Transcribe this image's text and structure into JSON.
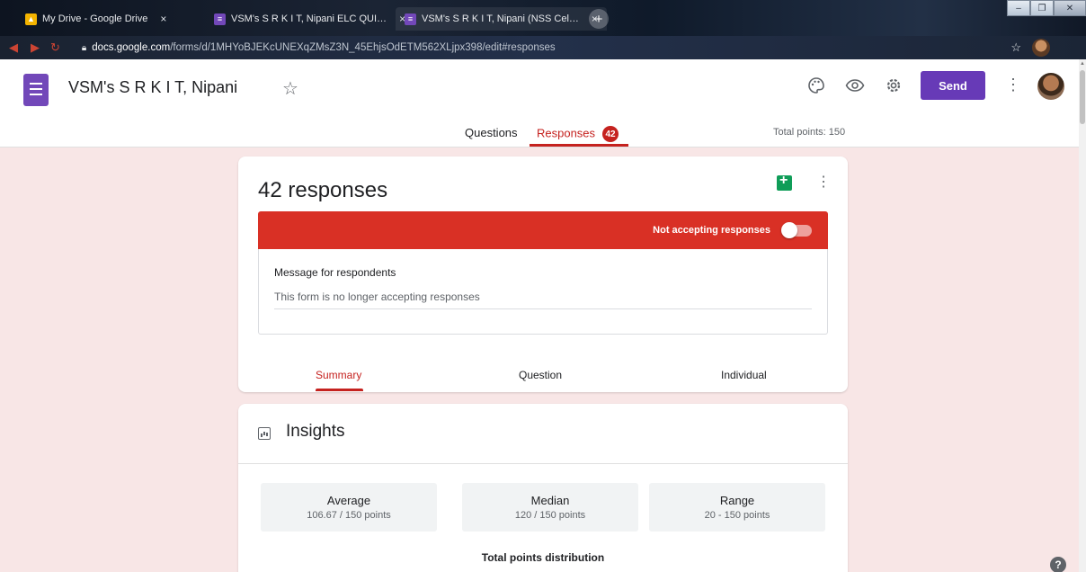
{
  "browser": {
    "tabs": [
      {
        "title": "My Drive - Google Drive",
        "close": "×"
      },
      {
        "title": "VSM's S R K I T, Nipani ELC QUI…",
        "close": "×"
      },
      {
        "title": "VSM's S R K I T, Nipani (NSS Cel…",
        "close": "×"
      }
    ],
    "new_tab": "+",
    "url_host": "docs.google.com",
    "url_path": "/forms/d/1MHYoBJEKcUNEXqZMsZ3N_45EhjsOdETM562XLjpx398/edit#responses"
  },
  "form": {
    "title": "VSM's S R K I T, Nipani",
    "send_label": "Send",
    "nav": {
      "questions": "Questions",
      "responses": "Responses",
      "responses_count": "42"
    },
    "total_points": "Total points: 150"
  },
  "responses": {
    "count_label": "42 responses",
    "status_label": "Not accepting responses",
    "message_label": "Message for respondents",
    "message_value": "This form is no longer accepting responses",
    "subtabs": {
      "summary": "Summary",
      "question": "Question",
      "individual": "Individual"
    }
  },
  "insights": {
    "title": "Insights",
    "stats": [
      {
        "label": "Average",
        "value": "106.67 / 150 points"
      },
      {
        "label": "Median",
        "value": "120 / 150 points"
      },
      {
        "label": "Range",
        "value": "20 - 150 points"
      }
    ],
    "distribution_title": "Total points distribution"
  },
  "colors": {
    "accent": "#673ab7",
    "red": "#c5221f",
    "banner": "#d93025",
    "sheets": "#0f9d58",
    "page_bg": "#f8e6e6"
  },
  "icons": [
    "palette-icon",
    "preview-eye-icon",
    "settings-gear-icon",
    "more-vert-icon",
    "star-icon",
    "sheets-icon",
    "insights-icon",
    "help-icon"
  ]
}
